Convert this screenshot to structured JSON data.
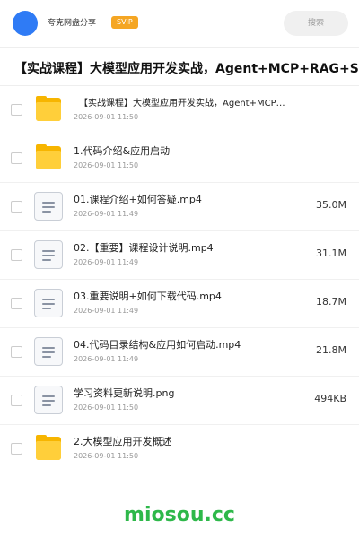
{
  "header": {
    "share_name": "夸克网盘分享",
    "badge": "SVIP",
    "search_label": "搜索"
  },
  "title": "【实战课程】大模型应用开发实战，Agent+MCP+RAG+S",
  "files": [
    {
      "type": "folder",
      "name": "【实战课程】大模型应用开发实战，Agent+MCP…",
      "date": "2026-09-01 11:50",
      "size": ""
    },
    {
      "type": "folder",
      "name": "1.代码介绍&应用启动",
      "date": "2026-09-01 11:50",
      "size": ""
    },
    {
      "type": "file",
      "name": "01.课程介绍+如何答疑.mp4",
      "date": "2026-09-01 11:49",
      "size": "35.0M"
    },
    {
      "type": "file",
      "name": "02.【重要】课程设计说明.mp4",
      "date": "2026-09-01 11:49",
      "size": "31.1M"
    },
    {
      "type": "file",
      "name": "03.重要说明+如何下载代码.mp4",
      "date": "2026-09-01 11:49",
      "size": "18.7M"
    },
    {
      "type": "file",
      "name": "04.代码目录结构&应用如何启动.mp4",
      "date": "2026-09-01 11:49",
      "size": "21.8M"
    },
    {
      "type": "file",
      "name": "学习资料更新说明.png",
      "date": "2026-09-01 11:50",
      "size": "494KB"
    },
    {
      "type": "folder",
      "name": "2.大模型应用开发概述",
      "date": "2026-09-01 11:50",
      "size": ""
    }
  ],
  "watermark": "miosou.cc"
}
